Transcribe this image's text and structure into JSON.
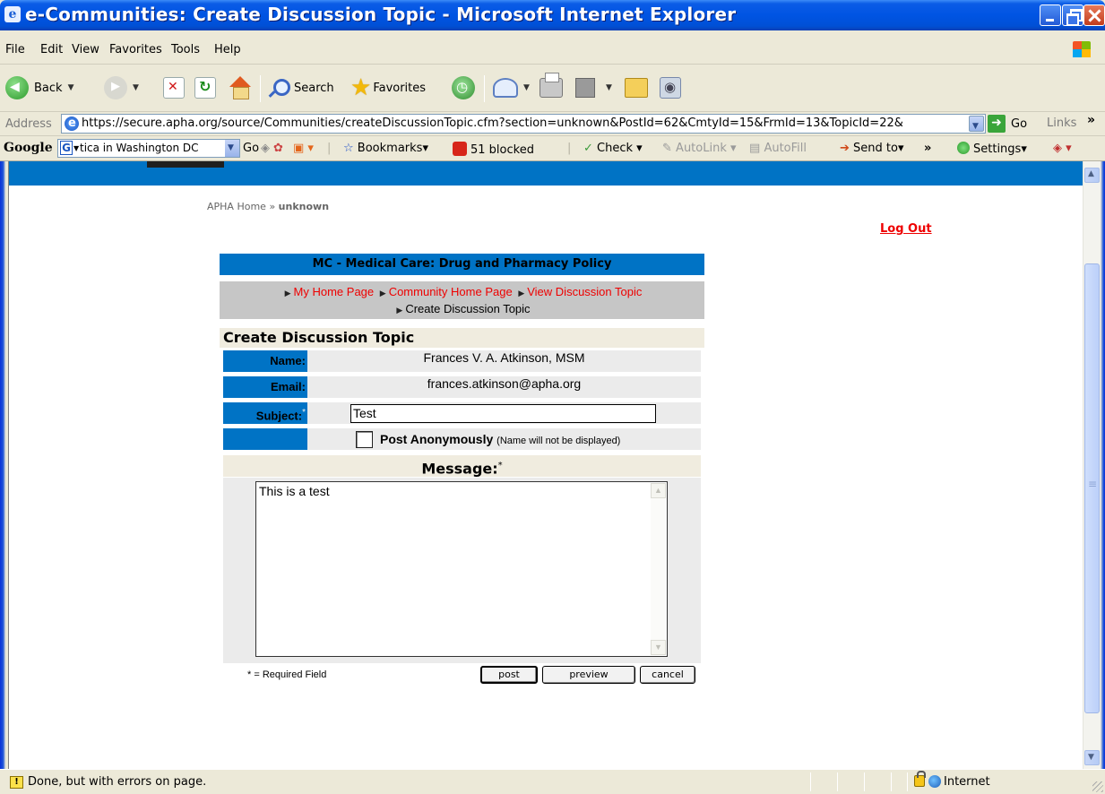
{
  "window": {
    "title": "e-Communities: Create Discussion Topic - Microsoft Internet Explorer"
  },
  "menu": [
    "File",
    "Edit",
    "View",
    "Favorites",
    "Tools",
    "Help"
  ],
  "toolbar": {
    "back": "Back",
    "search": "Search",
    "favorites": "Favorites"
  },
  "address": {
    "label": "Address",
    "url": "https://secure.apha.org/source/Communities/createDiscussionTopic.cfm?section=unknown&PostId=62&CmtyId=15&FrmId=13&TopicId=22&",
    "go": "Go",
    "links": "Links"
  },
  "google_bar": {
    "logo": "Google",
    "query": "tica in Washington DC",
    "go": "Go",
    "bookmarks": "Bookmarks",
    "blocked": "51 blocked",
    "check": "Check",
    "autolink": "AutoLink",
    "autofill": "AutoFill",
    "send_to": "Send to",
    "settings": "Settings"
  },
  "page": {
    "breadcrumb_home": "APHA Home",
    "breadcrumb_sep": "»",
    "breadcrumb_current": "unknown",
    "logout": "Log Out",
    "group_title": "MC - Medical Care: Drug and Pharmacy Policy",
    "nav": {
      "my_home": "My Home Page",
      "community_home": "Community Home Page",
      "view_topic": "View Discussion Topic",
      "current": "Create Discussion Topic"
    },
    "form_title": "Create Discussion Topic",
    "name_label": "Name:",
    "name_value": "Frances V. A. Atkinson, MSM",
    "email_label": "Email:",
    "email_value": "frances.atkinson@apha.org",
    "subject_label": "Subject:",
    "required_mark": "*",
    "subject_value": "Test",
    "anon_label": "Post Anonymously",
    "anon_note": "(Name will not be displayed)",
    "message_label": "Message:",
    "message_value": "This is a test",
    "required_note": "* = Required Field",
    "post": "post",
    "preview": "preview",
    "cancel": "cancel"
  },
  "status": {
    "text": "Done, but with errors on page.",
    "zone": "Internet"
  },
  "colors": {
    "accent_blue": "#0073c5",
    "link_red": "#e00000"
  }
}
